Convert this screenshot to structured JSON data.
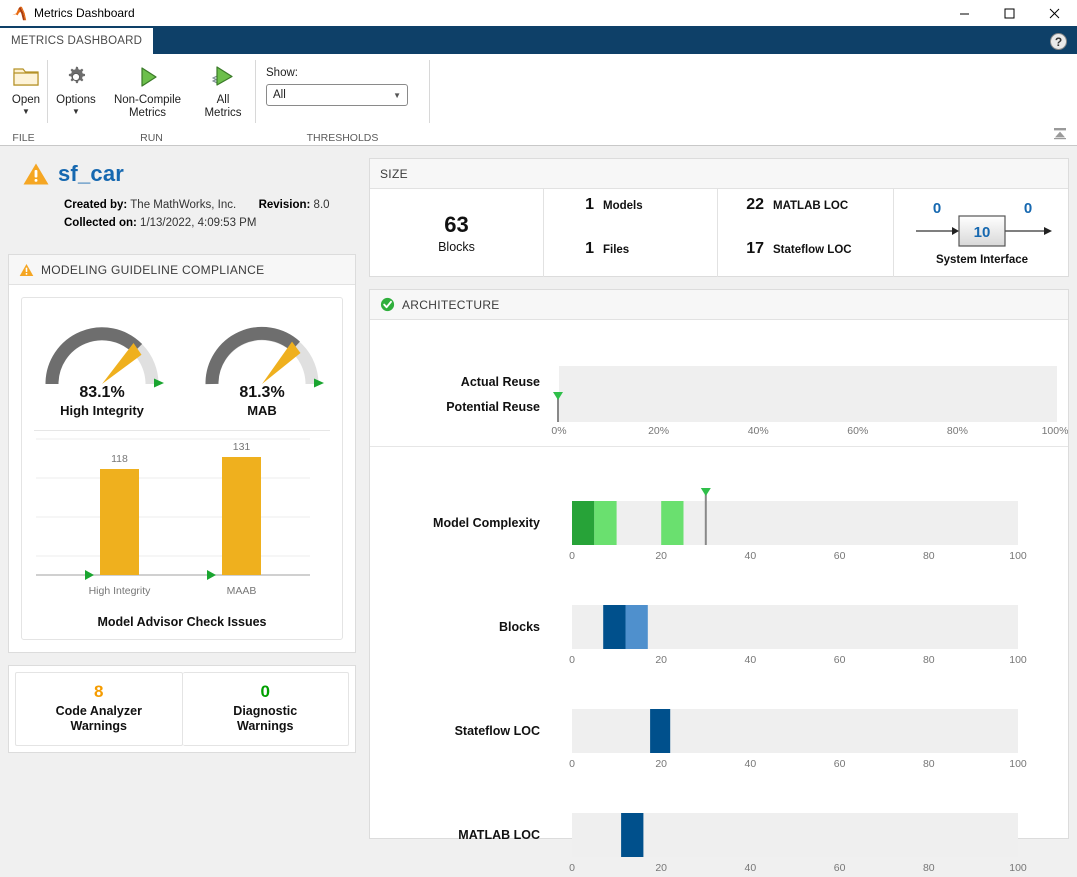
{
  "window": {
    "title": "Metrics Dashboard",
    "app_icon": "matlab-icon",
    "minimize_label": "–",
    "maximize_label": "❑",
    "close_label": "✕"
  },
  "ribbon": {
    "tab_label": "METRICS DASHBOARD",
    "help_label": "?",
    "collapse_label": "collapse-ribbon-icon",
    "groups": [
      {
        "name": "FILE",
        "buttons": [
          {
            "label": "Open",
            "icon": "folder-icon",
            "has_caret": true
          }
        ]
      },
      {
        "name": "RUN",
        "buttons": [
          {
            "label": "Options",
            "icon": "gear-icon",
            "has_caret": true
          },
          {
            "label": "Non-Compile Metrics",
            "icon": "play-icon",
            "has_caret": false
          },
          {
            "label": "All Metrics",
            "icon": "play-stack-icon",
            "has_caret": false
          }
        ]
      },
      {
        "name": "THRESHOLDS",
        "show_label": "Show:",
        "show_value": "All",
        "show_options": [
          "All"
        ]
      }
    ]
  },
  "model": {
    "status_icon": "warning-icon",
    "name": "sf_car",
    "created_by_label": "Created by:",
    "created_by_value": "The MathWorks, Inc.",
    "revision_label": "Revision:",
    "revision_value": "8.0",
    "collected_label": "Collected on:",
    "collected_value": "1/13/2022, 4:09:53 PM"
  },
  "size": {
    "header": "SIZE",
    "blocks_value": "63",
    "blocks_label": "Blocks",
    "models_value": "1",
    "models_label": "Models",
    "files_value": "1",
    "files_label": "Files",
    "matlab_loc_value": "22",
    "matlab_loc_label": "MATLAB LOC",
    "stateflow_loc_value": "17",
    "stateflow_loc_label": "Stateflow LOC",
    "interface_inputs": "0",
    "interface_center": "10",
    "interface_outputs": "0",
    "interface_label": "System Interface"
  },
  "compliance": {
    "header": "MODELING GUIDELINE COMPLIANCE",
    "status_icon": "warning-icon",
    "gauges": [
      {
        "value_text": "83.1%",
        "value": 83.1,
        "label": "High Integrity",
        "threshold": 100
      },
      {
        "value_text": "81.3%",
        "value": 81.3,
        "label": "MAB",
        "threshold": 100
      }
    ],
    "chart_data": {
      "type": "bar",
      "title": "Model Advisor Check Issues",
      "categories": [
        "High Integrity",
        "MAAB"
      ],
      "values": [
        118,
        131
      ],
      "value_labels": [
        "118",
        "131"
      ],
      "xlabel": "",
      "ylabel": "",
      "ylim": [
        0,
        160
      ],
      "grid": true,
      "bar_color": "#efb01e",
      "threshold_markers": [
        0,
        0
      ]
    }
  },
  "warnings": [
    {
      "value": "8",
      "label": "Code Analyzer Warnings",
      "color": "#f59c00"
    },
    {
      "value": "0",
      "label": "Diagnostic Warnings",
      "color": "#00a000"
    }
  ],
  "architecture": {
    "header": "ARCHITECTURE",
    "status_icon": "check-icon",
    "reuse_chart": {
      "type": "bar",
      "rows": [
        "Actual Reuse",
        "Potential Reuse"
      ],
      "values": [
        0,
        0
      ],
      "xlim": [
        0,
        100
      ],
      "ticks": [
        "0%",
        "20%",
        "40%",
        "60%",
        "80%",
        "100%"
      ],
      "tick_values": [
        0,
        20,
        40,
        60,
        80,
        100
      ],
      "threshold": 0
    },
    "distribution_charts": [
      {
        "label": "Model Complexity",
        "type": "bar",
        "xlim": [
          0,
          100
        ],
        "ticks": [
          "0",
          "20",
          "40",
          "60",
          "80",
          "100"
        ],
        "tick_values": [
          0,
          20,
          40,
          60,
          80,
          100
        ],
        "threshold": 30,
        "segments": [
          {
            "start": 0,
            "end": 5,
            "color": "#27a338"
          },
          {
            "start": 5,
            "end": 10,
            "color": "#6ae06f"
          },
          {
            "start": 20,
            "end": 25,
            "color": "#6ae06f"
          }
        ]
      },
      {
        "label": "Blocks",
        "type": "bar",
        "xlim": [
          0,
          100
        ],
        "ticks": [
          "0",
          "20",
          "40",
          "60",
          "80",
          "100"
        ],
        "tick_values": [
          0,
          20,
          40,
          60,
          80,
          100
        ],
        "threshold": null,
        "segments": [
          {
            "start": 7,
            "end": 12,
            "color": "#00508c"
          },
          {
            "start": 12,
            "end": 17,
            "color": "#4f90cd"
          }
        ]
      },
      {
        "label": "Stateflow LOC",
        "type": "bar",
        "xlim": [
          0,
          100
        ],
        "ticks": [
          "0",
          "20",
          "40",
          "60",
          "80",
          "100"
        ],
        "tick_values": [
          0,
          20,
          40,
          60,
          80,
          100
        ],
        "threshold": null,
        "segments": [
          {
            "start": 17.5,
            "end": 22,
            "color": "#00508c"
          }
        ]
      },
      {
        "label": "MATLAB LOC",
        "type": "bar",
        "xlim": [
          0,
          100
        ],
        "ticks": [
          "0",
          "20",
          "40",
          "60",
          "80",
          "100"
        ],
        "tick_values": [
          0,
          20,
          40,
          60,
          80,
          100
        ],
        "threshold": null,
        "segments": [
          {
            "start": 11,
            "end": 16,
            "color": "#00508c"
          }
        ]
      }
    ]
  },
  "colors": {
    "accent_blue": "#1668b0",
    "ribbon_blue": "#0e4068",
    "warning_orange": "#f5a623",
    "success_green": "#39a93b",
    "bar_orange": "#efb01e",
    "gauge_dark": "#6e6e6e",
    "gauge_light": "#e0e0e0",
    "track_gray": "#efefef"
  }
}
